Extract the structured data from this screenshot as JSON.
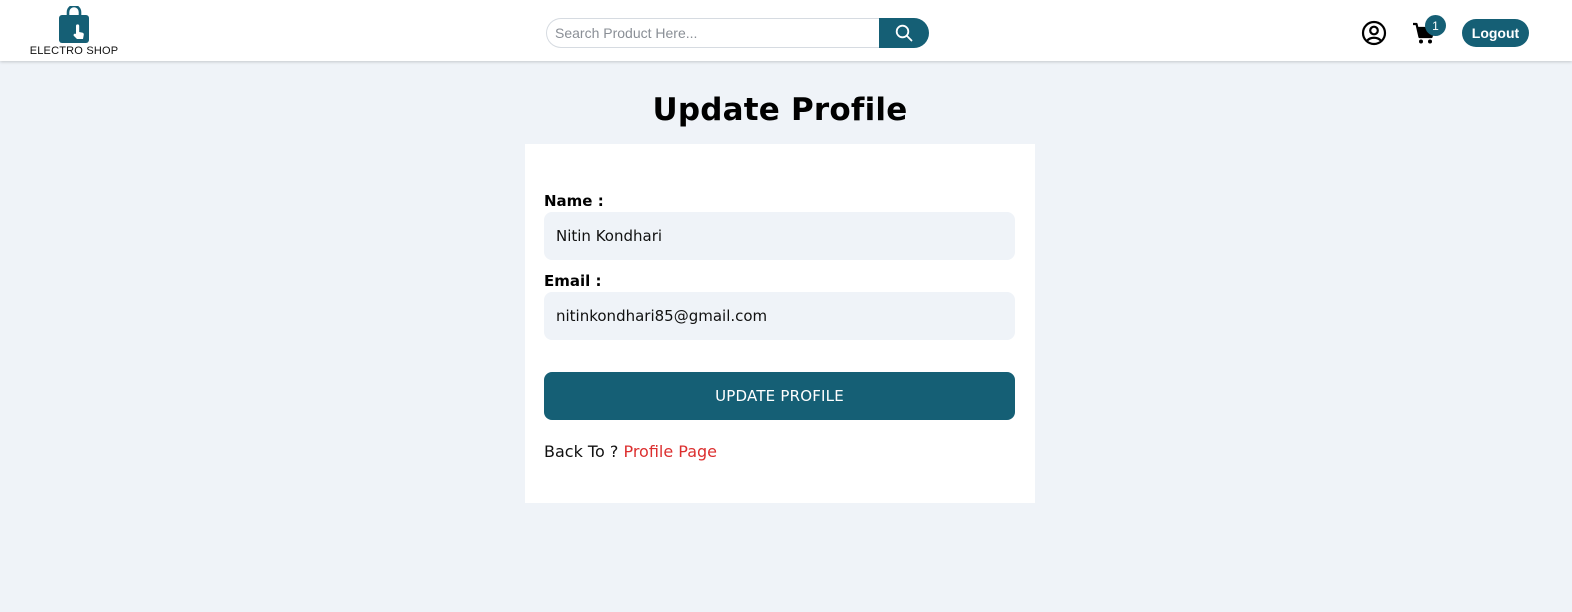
{
  "brand": {
    "name": "ELECTRO SHOP",
    "color": "#155f75"
  },
  "search": {
    "placeholder": "Search Product Here...",
    "value": "",
    "icon": "search-icon"
  },
  "header": {
    "user_icon": "user-circle-icon",
    "cart_icon": "shopping-cart-icon",
    "cart_count": "1",
    "logout_label": "Logout"
  },
  "page": {
    "title": "Update Profile"
  },
  "form": {
    "name_label": "Name :",
    "name_value": "Nitin Kondhari",
    "email_label": "Email :",
    "email_value": "nitinkondhari85@gmail.com",
    "submit_label": "UPDATE PROFILE",
    "back_prefix": "Back To ?",
    "back_link": "Profile Page",
    "link_color": "#dc2f2f"
  }
}
